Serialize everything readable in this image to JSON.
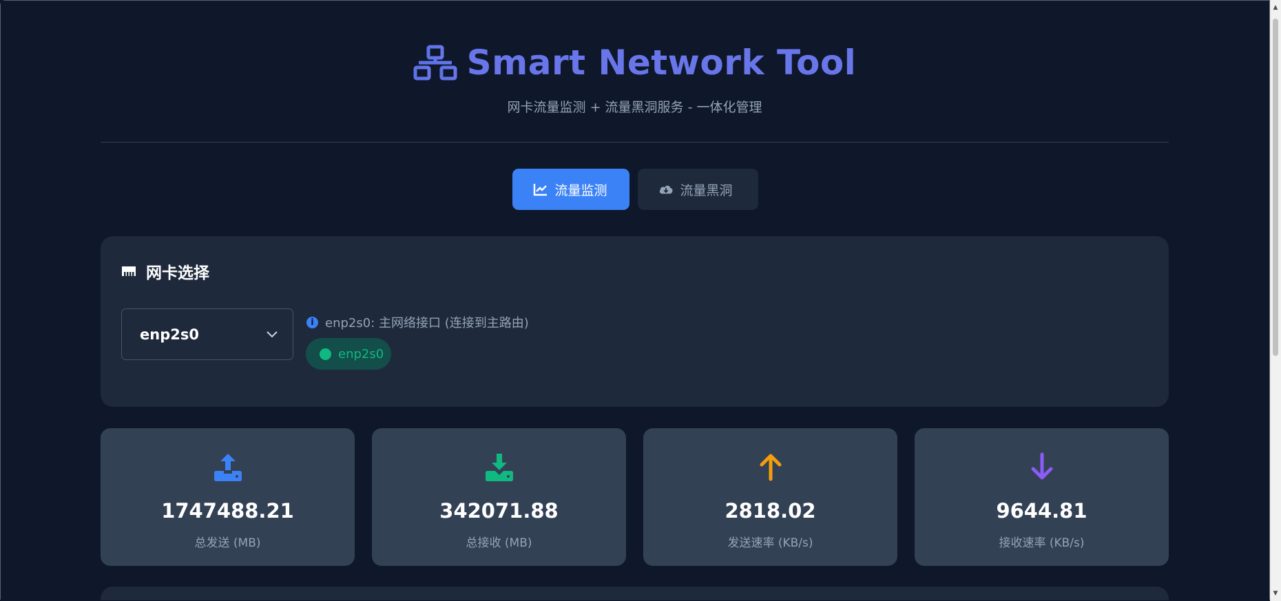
{
  "app": {
    "title": "Smart Network Tool",
    "subtitle": "网卡流量监测 + 流量黑洞服务 - 一体化管理",
    "accent_color": "#6876ea",
    "logo_icon": "network-icon"
  },
  "tabs": [
    {
      "label": "流量监测",
      "icon": "chart-line-icon",
      "active": true
    },
    {
      "label": "流量黑洞",
      "icon": "cloud-download-icon",
      "active": false
    }
  ],
  "nic_card": {
    "title": "网卡选择",
    "icon": "ethernet-icon",
    "select_value": "enp2s0",
    "info_text": "enp2s0: 主网络接口 (连接到主路由)",
    "status_badge": "enp2s0",
    "status_color": "#10b981"
  },
  "stats": [
    {
      "value": "1747488.21",
      "label": "总发送 (MB)",
      "icon": "upload-icon",
      "color": "#3b82f6"
    },
    {
      "value": "342071.88",
      "label": "总接收 (MB)",
      "icon": "download-icon",
      "color": "#10b981"
    },
    {
      "value": "2818.02",
      "label": "发送速率 (KB/s)",
      "icon": "arrow-up-icon",
      "color": "#f59e0b"
    },
    {
      "value": "9644.81",
      "label": "接收速率 (KB/s)",
      "icon": "arrow-down-icon",
      "color": "#8b5cf6"
    }
  ]
}
